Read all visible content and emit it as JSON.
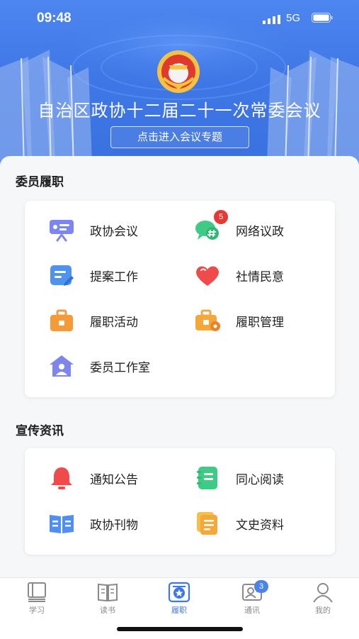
{
  "status_bar": {
    "time": "09:48",
    "network": "5G"
  },
  "banner": {
    "title": "自治区政协十二届二十一次常委会议",
    "button_label": "点击进入会议专题",
    "emblem_icon": "cppcc-emblem-icon"
  },
  "duty_section": {
    "title": "委员履职",
    "items": [
      {
        "label": "政协会议",
        "icon": "meeting-screen-icon",
        "color": "#7b86f2"
      },
      {
        "label": "网络议政",
        "icon": "chat-hash-icon",
        "color": "#3ecb85",
        "badge": "5"
      },
      {
        "label": "提案工作",
        "icon": "document-edit-icon",
        "color": "#4f93ef"
      },
      {
        "label": "社情民意",
        "icon": "heart-icon",
        "color": "#f04a4a"
      },
      {
        "label": "履职活动",
        "icon": "briefcase-icon",
        "color": "#f59a35"
      },
      {
        "label": "履职管理",
        "icon": "briefcase-settings-icon",
        "color": "#f5a83a"
      },
      {
        "label": "委员工作室",
        "icon": "house-person-icon",
        "color": "#7e86ee"
      }
    ]
  },
  "news_section": {
    "title": "宣传资讯",
    "items": [
      {
        "label": "通知公告",
        "icon": "bell-icon",
        "color": "#f04a4a"
      },
      {
        "label": "同心阅读",
        "icon": "notebook-icon",
        "color": "#3ecb85"
      },
      {
        "label": "政协刊物",
        "icon": "open-book-icon",
        "color": "#4f8fef"
      },
      {
        "label": "文史资料",
        "icon": "stacked-docs-icon",
        "color": "#f5b53a"
      }
    ]
  },
  "tabbar": {
    "active_color": "#3d78e6",
    "tabs": [
      {
        "label": "学习",
        "icon": "book-stack-icon"
      },
      {
        "label": "读书",
        "icon": "open-book-outline-icon"
      },
      {
        "label": "履职",
        "icon": "badge-star-icon",
        "active": true
      },
      {
        "label": "通讯",
        "icon": "contact-card-icon",
        "badge": "3"
      },
      {
        "label": "我的",
        "icon": "person-icon"
      }
    ]
  }
}
